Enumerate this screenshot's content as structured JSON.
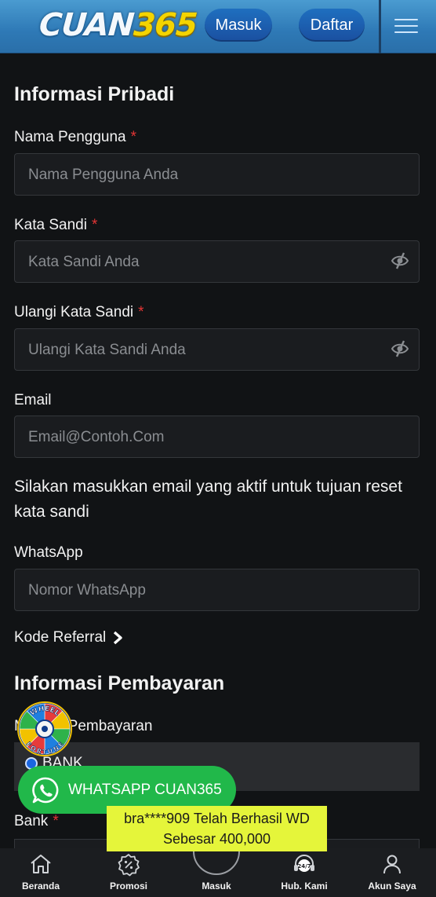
{
  "header": {
    "logo_part1": "CUAN",
    "logo_part2": "365",
    "login_label": "Masuk",
    "register_label": "Daftar"
  },
  "form": {
    "personal_title": "Informasi Pribadi",
    "username": {
      "label": "Nama Pengguna",
      "required": "*",
      "placeholder": "Nama Pengguna Anda"
    },
    "password": {
      "label": "Kata Sandi",
      "required": "*",
      "placeholder": "Kata Sandi Anda"
    },
    "confirm_password": {
      "label": "Ulangi Kata Sandi",
      "required": "*",
      "placeholder": "Ulangi Kata Sandi Anda"
    },
    "email": {
      "label": "Email",
      "placeholder": "Email@Contoh.Com"
    },
    "email_note": "Silakan masukkan email yang aktif untuk tujuan reset kata sandi",
    "whatsapp": {
      "label": "WhatsApp",
      "placeholder": "Nomor WhatsApp"
    },
    "referral_label": "Kode Referral",
    "payment_title": "Informasi Pembayaran",
    "payment_method_label": "Metode Pembayaran",
    "payment_option": "BANK",
    "bank": {
      "label": "Bank",
      "required": "*"
    }
  },
  "floating": {
    "whatsapp_button": "WHATSAPP CUAN365",
    "toast_line1": "bra****909 Telah Berhasil WD",
    "toast_line2": "Sebesar 400,000",
    "wheel_text": "WHEEL OF FORTUNE"
  },
  "bottom_nav": [
    {
      "label": "Beranda",
      "icon": "home-icon"
    },
    {
      "label": "Promosi",
      "icon": "promo-icon"
    },
    {
      "label": "Masuk",
      "icon": "login-icon"
    },
    {
      "label": "Hub. Kami",
      "icon": "support-24-7-icon"
    },
    {
      "label": "Akun Saya",
      "icon": "user-icon"
    }
  ],
  "colors": {
    "background": "#111315",
    "header": "#3a8ac4",
    "button": "#1a5aa8",
    "required": "#e53535",
    "whatsapp": "#21b84a",
    "toast": "#e5f53a"
  }
}
